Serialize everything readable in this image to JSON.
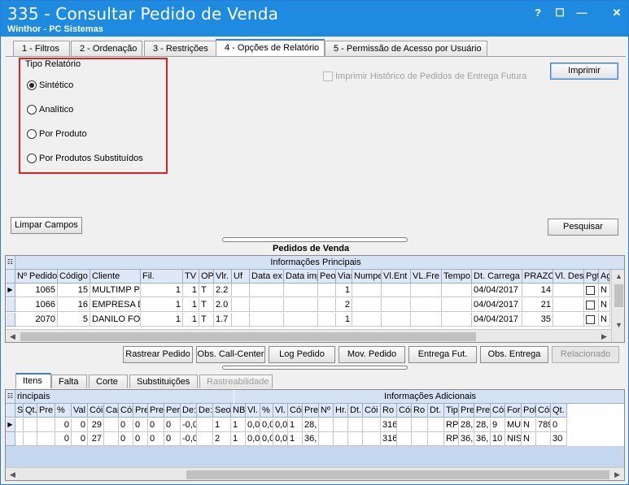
{
  "window": {
    "title": "335 - Consultar Pedido de Venda",
    "subtitle": "Winthor - PC Sistemas",
    "controls": [
      "?",
      "☐",
      "—",
      "✕"
    ]
  },
  "tabs": [
    {
      "label": "1 - Filtros"
    },
    {
      "label": "2 - Ordenação"
    },
    {
      "label": "3 - Restrições"
    },
    {
      "label": "4 - Opções de Relatório"
    },
    {
      "label": "5 - Permissão de Acesso por Usuário"
    }
  ],
  "report_options": {
    "group_title": "Tipo Relatório",
    "options": [
      {
        "label": "Sintético",
        "selected": true
      },
      {
        "label": "Analítico",
        "selected": false
      },
      {
        "label": "Por Produto",
        "selected": false
      },
      {
        "label": "Por Produtos Substituídos",
        "selected": false
      }
    ],
    "history_checkbox": "Imprimir Histórico de Pedidos de Entrega Futura",
    "print_button": "Imprimir"
  },
  "actions": {
    "clear": "Limpar Campos",
    "search": "Pesquisar"
  },
  "orders": {
    "caption": "Pedidos de  Venda",
    "band": "Informações Principais",
    "columns": [
      "Nº Pedido",
      "Código",
      "Cliente",
      "Fil.",
      "TV",
      "OP",
      "Vlr.",
      "Uf",
      "Data ex",
      "Data imp",
      "Peo",
      "Vias",
      "Numpe",
      "Vl.Ent",
      "VL.Fre",
      "Tempo",
      "Dt. Carrega",
      "PRAZO",
      "Vl. Des",
      "Pgt",
      "Ag"
    ],
    "rows": [
      [
        "1065",
        "15",
        "MULTIMP PR",
        "1",
        "1",
        "T",
        "2.2",
        "",
        "",
        "",
        "",
        "1",
        "",
        "",
        "",
        "",
        "04/04/2017",
        "14",
        "",
        "",
        "N"
      ],
      [
        "1066",
        "16",
        "EMPRESA DE",
        "1",
        "1",
        "T",
        "2.0",
        "",
        "",
        "",
        "",
        "2",
        "",
        "",
        "",
        "",
        "04/04/2017",
        "21",
        "",
        "",
        "N"
      ],
      [
        "2070",
        "5",
        "DANILO FON",
        "1",
        "1",
        "T",
        "1.7",
        "",
        "",
        "",
        "",
        "1",
        "",
        "",
        "",
        "",
        "04/04/2017",
        "35",
        "",
        "",
        "N"
      ]
    ]
  },
  "order_actions": [
    "Rastrear Pedido",
    "Obs. Call-Center",
    "Log Pedido",
    "Mov. Pedido",
    "Entrega Fut.",
    "Obs. Entrega",
    "Relacionado"
  ],
  "bottom_tabs": [
    "Itens",
    "Falta",
    "Corte",
    "Substituições",
    "Rastreabilidade"
  ],
  "items": {
    "band_left": "rincipais",
    "band_right": "Informações Adicionais",
    "columns": [
      "Se",
      "Qt.",
      "Pre",
      "%",
      "Val",
      "Cói",
      "Cai",
      "Cói",
      "Pre",
      "Pre",
      "Per",
      "De:",
      "De:",
      "Seo",
      "NBI",
      "Vl.",
      "%",
      "Vl.",
      "Cói",
      "Pre",
      "Nº",
      "Hr.",
      "Dt.",
      "Cói",
      "Ro",
      "Cói",
      "Ro",
      "Dt.",
      "Tip",
      "Pre",
      "Pre",
      "Cói",
      "For",
      "Pol",
      "Cói",
      "Qt."
    ],
    "rows": [
      [
        "",
        "",
        "",
        "0",
        "0",
        "29",
        "",
        "0",
        "0",
        "0",
        "0",
        "-0,0",
        "",
        "1",
        "1",
        "0,0",
        "0,0",
        "0,0",
        "1",
        "28,",
        "",
        "",
        "",
        "",
        "316",
        "",
        "",
        "",
        "RP",
        "28,",
        "28,",
        "9",
        "MU",
        "N",
        "789",
        "0"
      ],
      [
        "",
        "",
        "",
        "0",
        "0",
        "27",
        "",
        "0",
        "0",
        "0",
        "0",
        "-0,0",
        "",
        "2",
        "1",
        "0,0",
        "0,0",
        "0,0",
        "1",
        "36,",
        "",
        "",
        "",
        "",
        "316",
        "",
        "",
        "",
        "RP",
        "36,",
        "36,",
        "10",
        "NIS",
        "N",
        "",
        "30"
      ]
    ]
  },
  "colors": {
    "titlebar": "#1e8be0",
    "highlight_box": "#e02020"
  }
}
